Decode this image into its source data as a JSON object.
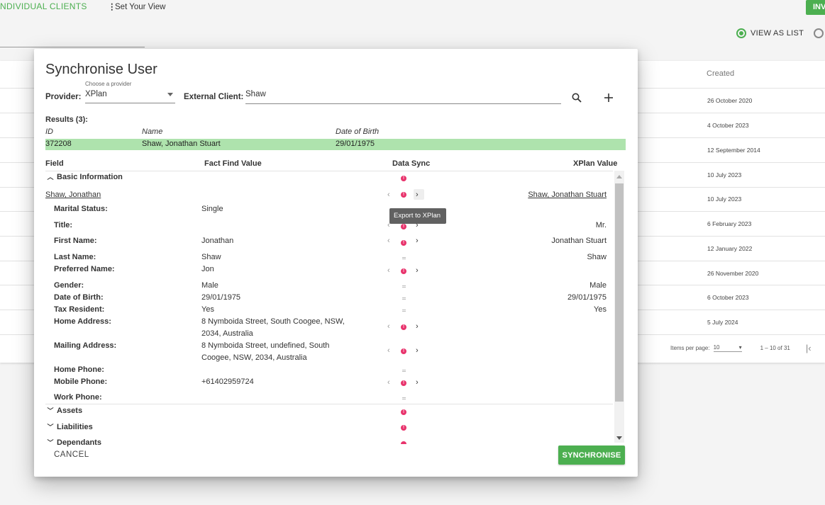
{
  "background": {
    "tab_label": "NDIVIDUAL CLIENTS",
    "set_view_label": "Set Your View",
    "invite_button": "INV",
    "view_as_list": "VIEW AS LIST",
    "created_header": "Created",
    "dates": [
      "26 October 2020",
      "4 October 2023",
      "12 September 2014",
      "10 July 2023",
      "10 July 2023",
      "6 February 2023",
      "12 January 2022",
      "26 November 2020",
      "6 October 2023",
      "5 July 2024"
    ],
    "items_per_page_label": "Items per page:",
    "items_per_page_value": "10",
    "range_label": "1 – 10 of 31"
  },
  "dialog": {
    "title": "Synchronise User",
    "provider_label": "Provider:",
    "provider_hint": "Choose a provider",
    "provider_value": "XPlan",
    "external_client_label": "External Client:",
    "external_client_value": "Shaw",
    "results_label": "Results (3):",
    "results_columns": [
      "ID",
      "Name",
      "Date of Birth"
    ],
    "selected_result": {
      "id": "372208",
      "name": "Shaw, Jonathan Stuart",
      "dob": "29/01/1975"
    },
    "columns": {
      "field": "Field",
      "fact_find": "Fact Find Value",
      "data_sync": "Data Sync",
      "xplan": "XPlan Value"
    },
    "basic_info_label": "Basic Information",
    "client_name_ff": "Shaw, Jonathan",
    "client_name_xp": "Shaw, Jonathan Stuart",
    "tooltip": "Export to XPlan",
    "rows": [
      {
        "label": "Marital Status:",
        "ff": "Single",
        "xp": ""
      },
      {
        "label": "Title:",
        "ff": "",
        "xp": "Mr."
      },
      {
        "label": "First Name:",
        "ff": "Jonathan",
        "xp": "Jonathan Stuart"
      },
      {
        "label": "Last Name:",
        "ff": "Shaw",
        "xp": "Shaw"
      },
      {
        "label": "Preferred Name:",
        "ff": "Jon",
        "xp": ""
      },
      {
        "label": "Gender:",
        "ff": "Male",
        "xp": "Male"
      },
      {
        "label": "Date of Birth:",
        "ff": "29/01/1975",
        "xp": "29/01/1975"
      },
      {
        "label": "Tax Resident:",
        "ff": "Yes",
        "xp": "Yes"
      },
      {
        "label": "Home Address:",
        "ff": "8 Nymboida Street, South Coogee, NSW, 2034, Australia",
        "xp": ""
      },
      {
        "label": "Mailing Address:",
        "ff": "8 Nymboida Street, undefined, South Coogee, NSW, 2034, Australia",
        "xp": ""
      },
      {
        "label": "Home Phone:",
        "ff": "",
        "xp": ""
      },
      {
        "label": "Mobile Phone:",
        "ff": "+61402959724",
        "xp": ""
      },
      {
        "label": "Work Phone:",
        "ff": "",
        "xp": ""
      }
    ],
    "sections": [
      "Assets",
      "Liabilities",
      "Dependants"
    ],
    "cancel_label": "CANCEL",
    "synchronise_label": "SYNCHRONISE"
  },
  "colors": {
    "accent": "#4caf50",
    "selected_row": "#aee3ad",
    "sync_dot": "#e8336c"
  }
}
